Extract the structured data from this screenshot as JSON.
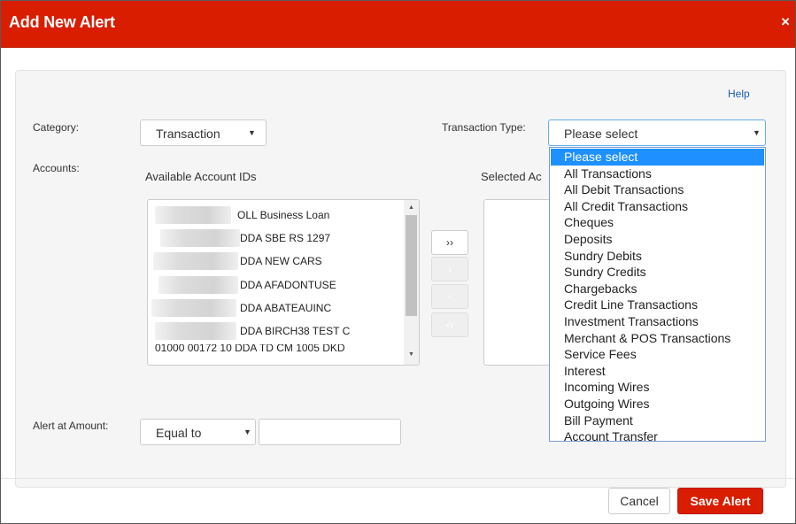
{
  "dialog": {
    "title": "Add New Alert",
    "close_glyph": "×"
  },
  "help_label": "Help",
  "category": {
    "label": "Category:",
    "value": "Transaction"
  },
  "transaction_type": {
    "label": "Transaction Type:",
    "value": "Please select",
    "options": [
      "Please select",
      "All Transactions",
      "All Debit Transactions",
      "All Credit Transactions",
      "Cheques",
      "Deposits",
      "Sundry Debits",
      "Sundry Credits",
      "Chargebacks",
      "Credit Line Transactions",
      "Investment Transactions",
      "Merchant & POS Transactions",
      "Service Fees",
      "Interest",
      "Incoming Wires",
      "Outgoing Wires",
      "Bill Payment",
      "Account Transfer"
    ]
  },
  "accounts": {
    "label": "Accounts:",
    "available_header": "Available Account IDs",
    "selected_header": "Selected Ac",
    "items": [
      "OLL Business Loan",
      "DDA SBE RS 1297",
      "DDA NEW CARS",
      "DDA AFADONTUSE",
      "DDA ABATEAUINC",
      "DDA BIRCH38 TEST C",
      "01000 00172 10 DDA TD CM 1005 DKD"
    ],
    "move_buttons": [
      "››",
      "›",
      "‹",
      "‹‹"
    ]
  },
  "alert_amount": {
    "label": "Alert at Amount:",
    "operator": "Equal to",
    "amount": ""
  },
  "footer": {
    "cancel_label": "Cancel",
    "save_label": "Save Alert"
  },
  "colors": {
    "brand_red": "#d81d00",
    "highlight_blue": "#1e90ff",
    "link_blue": "#1a5fb4"
  }
}
